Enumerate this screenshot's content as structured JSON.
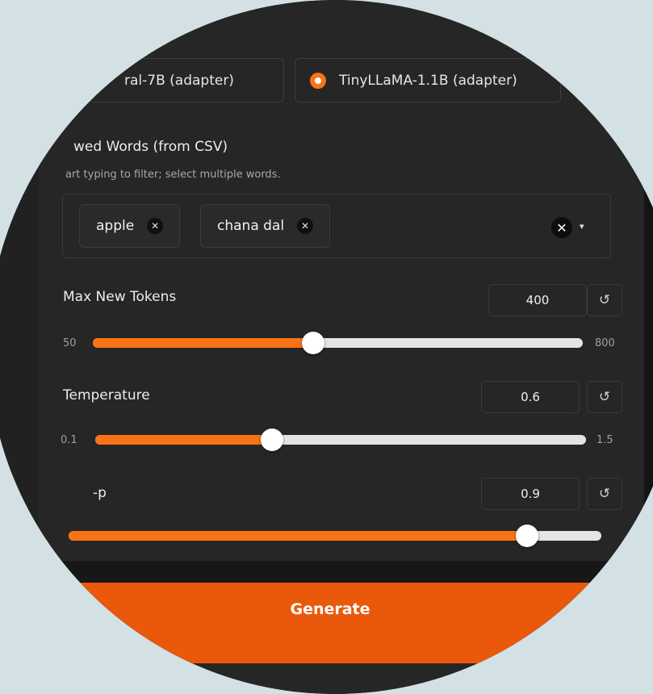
{
  "model_options": [
    {
      "label": "ral-7B (adapter)",
      "selected": false
    },
    {
      "label": "TinyLLaMA-1.1B (adapter)",
      "selected": true
    }
  ],
  "allowed_words": {
    "title": "wed Words (from CSV)",
    "hint": "art typing to filter; select multiple words.",
    "chips": [
      "apple",
      "chana dal"
    ],
    "chip_remove_glyph": "✕",
    "clear_glyph": "✕",
    "caret_glyph": "▾"
  },
  "sliders": [
    {
      "label": "Max New Tokens",
      "value": "400",
      "min": "50",
      "max": "800",
      "fraction": 0.45
    },
    {
      "label": "Temperature",
      "value": "0.6",
      "min": "0.1",
      "max": "1.5",
      "fraction": 0.36
    },
    {
      "label": "-p",
      "value": "0.9",
      "min": "",
      "max": "",
      "fraction": 0.86
    }
  ],
  "reset_glyph": "↺",
  "generate_label": "Generate",
  "colors": {
    "accent": "#f97316",
    "button": "#ea580c",
    "panel": "#262626",
    "outer_bg": "#d3e1e4"
  }
}
